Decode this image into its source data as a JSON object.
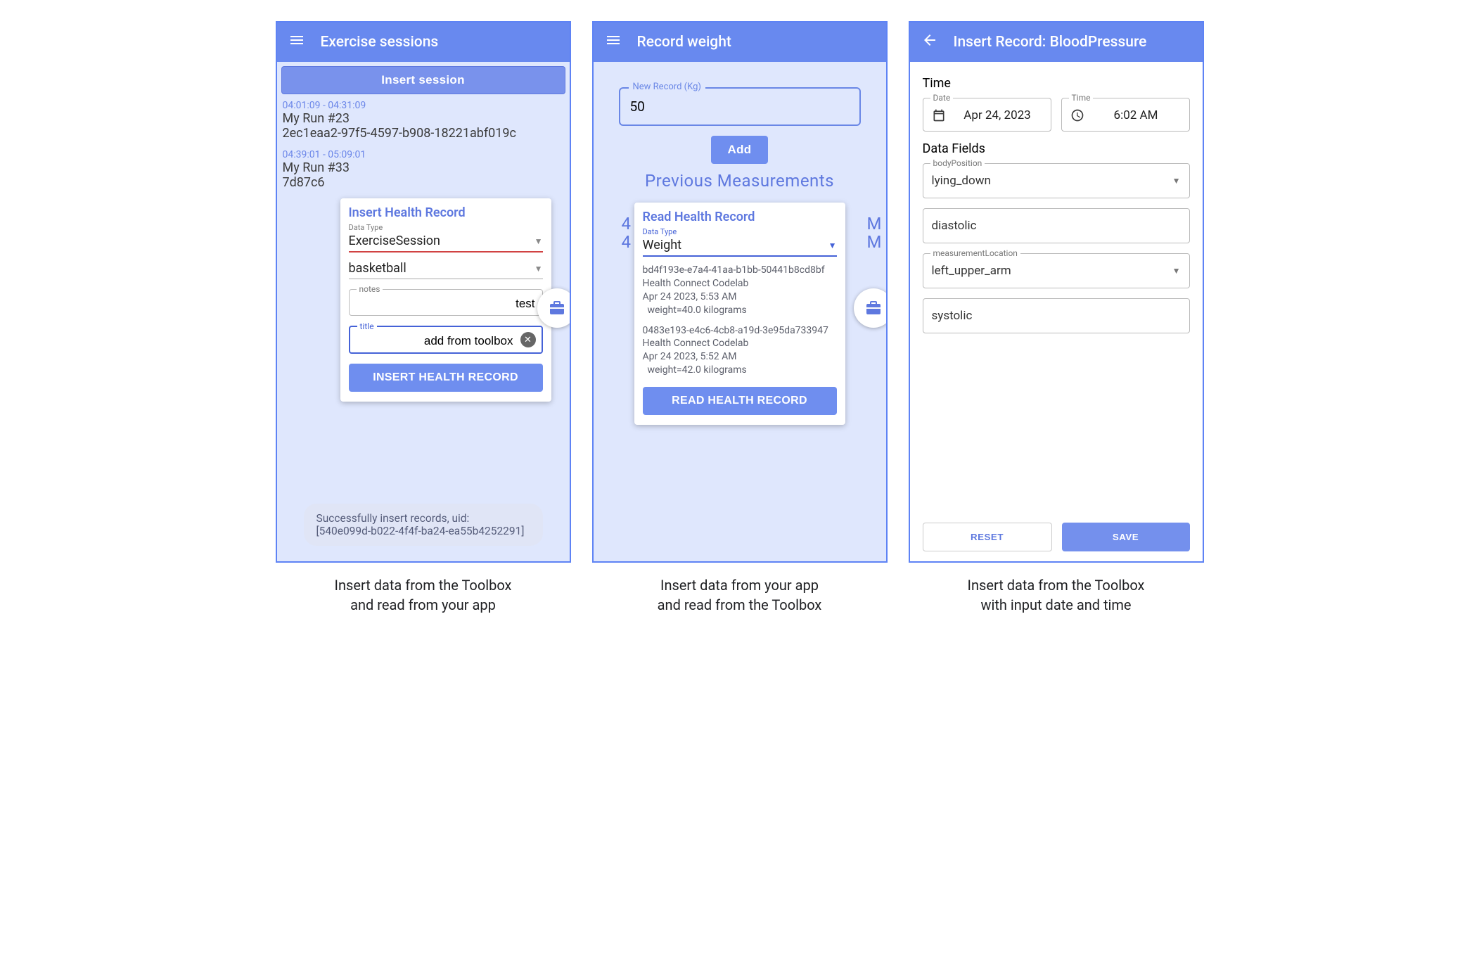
{
  "screens": [
    {
      "appbar_title": "Exercise sessions",
      "insert_session_btn": "Insert session",
      "sessions": [
        {
          "time": "04:01:09 - 04:31:09",
          "title": "My Run #23",
          "uid": "2ec1eaa2-97f5-4597-b908-18221abf019c"
        },
        {
          "time": "04:39:01 - 05:09:01",
          "title": "My Run #33",
          "uid": "7d87c6"
        }
      ],
      "card": {
        "title": "Insert Health Record",
        "data_type_label": "Data Type",
        "data_type_value": "ExerciseSession",
        "exercise_type_value": "basketball",
        "notes_label": "notes",
        "notes_value": "test",
        "title_label": "title",
        "title_value": "add from toolbox",
        "submit": "INSERT HEALTH RECORD"
      },
      "toast_line1": "Successfully insert records, uid:",
      "toast_line2": "[540e099d-b022-4f4f-ba24-ea55b4252291]",
      "caption": "Insert data from the Toolbox\nand read from your app"
    },
    {
      "appbar_title": "Record weight",
      "new_record_label": "New Record (Kg)",
      "new_record_value": "50",
      "add_btn": "Add",
      "prev_header": "Previous Measurements",
      "side_chars": {
        "l": "4",
        "r": "M",
        "l2": "4",
        "r2": "M"
      },
      "card": {
        "title": "Read Health Record",
        "data_type_label": "Data Type",
        "data_type_value": "Weight",
        "records": [
          {
            "uid": "bd4f193e-e7a4-41aa-b1bb-50441b8cd8bf",
            "app": "Health Connect Codelab",
            "ts": "Apr 24 2023, 5:53 AM",
            "val": "  weight=40.0 kilograms"
          },
          {
            "uid": "0483e193-e4c6-4cb8-a19d-3e95da733947",
            "app": "Health Connect Codelab",
            "ts": "Apr 24 2023, 5:52 AM",
            "val": "  weight=42.0 kilograms"
          }
        ],
        "submit": "READ HEALTH RECORD"
      },
      "caption": "Insert data from your app\nand read from the Toolbox"
    },
    {
      "appbar_title": "Insert Record: BloodPressure",
      "time_heading": "Time",
      "date_label": "Date",
      "date_value": "Apr 24, 2023",
      "time_label": "Time",
      "time_value": "6:02 AM",
      "data_fields_heading": "Data Fields",
      "fields": {
        "bodyPosition_label": "bodyPosition",
        "bodyPosition_value": "lying_down",
        "diastolic_label": "diastolic",
        "measurementLocation_label": "measurementLocation",
        "measurementLocation_value": "left_upper_arm",
        "systolic_label": "systolic"
      },
      "reset_btn": "RESET",
      "save_btn": "SAVE",
      "caption": "Insert data from the Toolbox\nwith input date and time"
    }
  ]
}
